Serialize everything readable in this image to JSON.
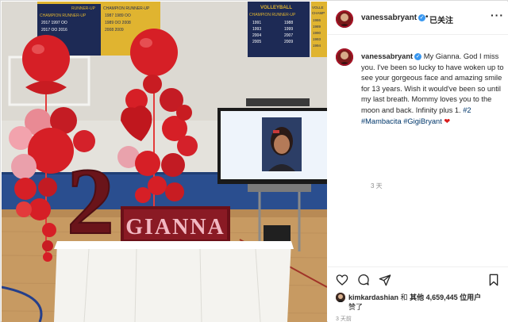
{
  "post": {
    "username": "vanessabryant",
    "verified_mark": "✓",
    "header_dot": "•",
    "follow_label": "已关注",
    "more_label": "···",
    "avatar_icon": "profile-avatar-icon",
    "caption_text": "My Gianna. God I miss you. I've been so lucky to have woken up to see your gorgeous face and amazing smile for 13 years. Wish it would've been so until my last breath. Mommy loves you to the moon and back. Infinity plus 1.",
    "hashtags": [
      "#2",
      "#Mambacita",
      "#GigiBryant"
    ],
    "heart_emoji": "❤",
    "caption_age": "3 天"
  },
  "photo": {
    "banner_left": [
      "RUNNER-UP",
      "CHAMPION  RUNNER-UP",
      "2017  1997 OO",
      "2017 OO 2016"
    ],
    "banner_mid": [
      "CHAMPION  RUNNER-UP",
      "1987  1989 OO",
      "1989 OO  2008",
      "2008  2009"
    ],
    "banner_right_title": "VOLLEYBALL",
    "banner_right_sub": "CHAMPION  RUNNER-UP",
    "banner_right_years_left": [
      "1991",
      "1993",
      "2004",
      "2005"
    ],
    "banner_right_years_right": [
      "1988",
      "1999",
      "2007",
      "2009"
    ],
    "banner_far": [
      "VOLLE",
      "CHAMP",
      "1986",
      "1989",
      "1990",
      "1993",
      "1994"
    ],
    "number_display": "2",
    "name_display": "GIANNA"
  },
  "actions": {
    "like_icon": "heart-icon",
    "comment_icon": "comment-icon",
    "share_icon": "share-icon",
    "save_icon": "bookmark-icon",
    "liker_username": "kimkardashian",
    "liker_join": "和",
    "others_label": "其他",
    "likes_count": "4,659,445",
    "users_label": "位用户",
    "liked_label": "赞了",
    "post_age": "3 天前"
  },
  "colors": {
    "accent_blue": "#3897f0",
    "hashtag_blue": "#00376b",
    "balloon_red": "#d61f26",
    "gym_blue": "#2a4e8f",
    "banner_navy": "#1d2a55",
    "banner_gold": "#e0b430"
  }
}
